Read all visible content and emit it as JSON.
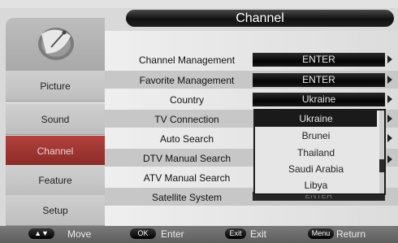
{
  "title": "Channel",
  "sidebar": {
    "icon": "satellite-dish-icon",
    "items": [
      {
        "label": "Picture"
      },
      {
        "label": "Sound"
      },
      {
        "label": "Channel"
      },
      {
        "label": "Feature"
      },
      {
        "label": "Setup"
      }
    ]
  },
  "rows": [
    {
      "label": "Channel Management",
      "value": "ENTER"
    },
    {
      "label": "Favorite Management",
      "value": "ENTER"
    },
    {
      "label": "Country",
      "value": "Ukraine"
    },
    {
      "label": "TV Connection"
    },
    {
      "label": "Auto Search"
    },
    {
      "label": "DTV Manual Search"
    },
    {
      "label": "ATV Manual Search"
    },
    {
      "label": "Satellite System",
      "value": "ENTER"
    }
  ],
  "dropdown": {
    "selected": "Ukraine",
    "options": [
      "Ukraine",
      "Brunei",
      "Thailand",
      "Saudi Arabia",
      "Libya"
    ]
  },
  "footer": {
    "move": {
      "key": "▲▼",
      "label": "Move"
    },
    "enter": {
      "key": "OK",
      "label": "Enter"
    },
    "exit": {
      "key": "Exit",
      "label": "Exit"
    },
    "return": {
      "key": "Menu",
      "label": "Return"
    }
  },
  "colors": {
    "active_tab": "#9b3330",
    "panel": "#e6e6e6",
    "value_box": "#111111"
  }
}
